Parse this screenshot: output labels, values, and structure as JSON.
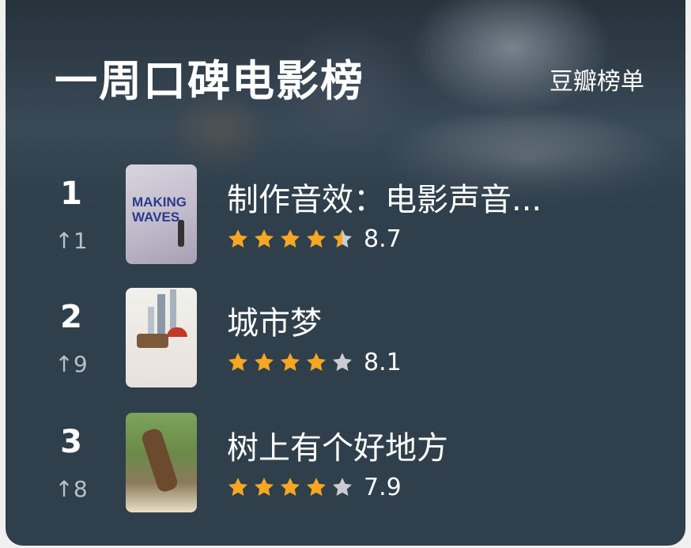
{
  "header": {
    "title": "一周口碑电影榜",
    "source": "豆瓣榜单"
  },
  "colors": {
    "card_bg": "#2f3f4b",
    "star_filled": "#f5a623",
    "star_empty": "#c9cdd1",
    "text": "#ffffff",
    "subtext": "#b8c0c6"
  },
  "movies": [
    {
      "rank": "1",
      "change": "↑1",
      "title": "制作音效：电影声音...",
      "score": "8.7",
      "stars": 4.5,
      "poster_text": "MAKING WAVES"
    },
    {
      "rank": "2",
      "change": "↑9",
      "title": "城市梦",
      "score": "8.1",
      "stars": 4
    },
    {
      "rank": "3",
      "change": "↑8",
      "title": "树上有个好地方",
      "score": "7.9",
      "stars": 4
    }
  ]
}
